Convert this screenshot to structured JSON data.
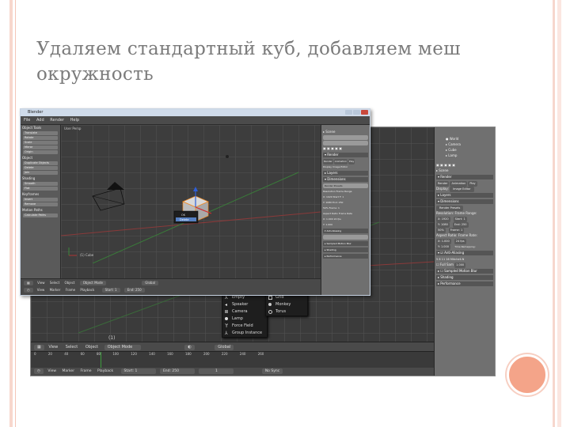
{
  "slide": {
    "title": "Удаляем стандартный куб, добавляем меш окружность"
  },
  "front_window": {
    "title": "Blender",
    "menu": [
      "File",
      "Add",
      "Render",
      "Help"
    ],
    "tool_panel": {
      "header": "Object Tools",
      "buttons": [
        "Translate",
        "Rotate",
        "Scale",
        "Mirror",
        "Origin",
        "Object",
        "Duplicate Objects",
        "Delete",
        "Join",
        "Shading",
        "Smooth",
        "Flat",
        "Keyframes",
        "Insert",
        "Remove",
        "Motion Paths",
        "Calculate Paths"
      ]
    },
    "viewport_label": "User Persp",
    "bottom_menu": [
      "View",
      "Select",
      "Object",
      "Object Mode",
      "Global"
    ],
    "timeline": [
      "View",
      "Marker",
      "Frame",
      "Playback",
      "Start: 1",
      "End: 250"
    ],
    "props_panel": [
      "Scene",
      "Render",
      "Render",
      "Animation",
      "Play",
      "Display",
      "Image Editor",
      "Layers",
      "Dimensions",
      "Render Presets",
      "Resolution",
      "Frame Range",
      "X: 1920",
      "Start F: 1",
      "Y: 1080",
      "End: 250",
      "50%",
      "Frame: 1",
      "Aspect Ratio",
      "Frame Rate",
      "X: 1.000",
      "24 fps",
      "Y: 1.000",
      "Anti-Aliasing",
      "Sampled Motion Blur",
      "Shading",
      "Performance"
    ]
  },
  "back_window": {
    "header_menu": [
      "View",
      "Select",
      "Object",
      "Object Mode",
      "Global"
    ],
    "timeline_numbers": [
      "0",
      "20",
      "40",
      "60",
      "80",
      "100",
      "120",
      "140",
      "160",
      "180",
      "200",
      "220",
      "240",
      "260"
    ],
    "timeline_bar": [
      "View",
      "Marker",
      "Frame",
      "Playback",
      "Start: 1",
      "End: 250",
      "1",
      "No Sync"
    ],
    "props_panel": {
      "outliner": [
        "World",
        "Camera",
        "Cube",
        "Lamp"
      ],
      "scene": "Scene",
      "render_header": "Render",
      "render_buttons": [
        "Render",
        "Animation",
        "Play"
      ],
      "display_label": "Display:",
      "display_value": "Image Editor",
      "layers": "Layers",
      "dimensions": "Dimensions",
      "render_presets": "Render Presets",
      "resolution": "Resolution:",
      "frame_range": "Frame Range:",
      "res_x": "X: 1920",
      "start": "Start: 1",
      "res_y": "Y: 1080",
      "end": "End: 250",
      "percent": "50%",
      "frame": "Frame: 1",
      "aspect_ratio": "Aspect Ratio:",
      "frame_rate": "Frame Rate:",
      "aspect_x": "X: 1.000",
      "fps": "24 fps",
      "aspect_y": "Y: 1.000",
      "time_remap": "Time Remapping:",
      "anti_aliasing": "Anti-Aliasing",
      "aa_values": [
        "5",
        "8",
        "11",
        "16",
        "Mitchell-N"
      ],
      "full_sample": "Full Sam",
      "size": "1.000",
      "motion_blur": "Sampled Motion Blur",
      "shading": "Shading",
      "performance": "Performance"
    },
    "add_menu": [
      "Empty",
      "Speaker",
      "Camera",
      "Lamp",
      "Force Field",
      "Group Instance"
    ],
    "mesh_submenu": [
      "Grid",
      "Monkey",
      "Torus"
    ]
  },
  "colors": {
    "frame_accent": "#f7d7cd",
    "circle": "#f4a489",
    "title_text": "#7b7b7b",
    "blender_bg": "#3c3c3c",
    "selection": "#5680c2"
  }
}
